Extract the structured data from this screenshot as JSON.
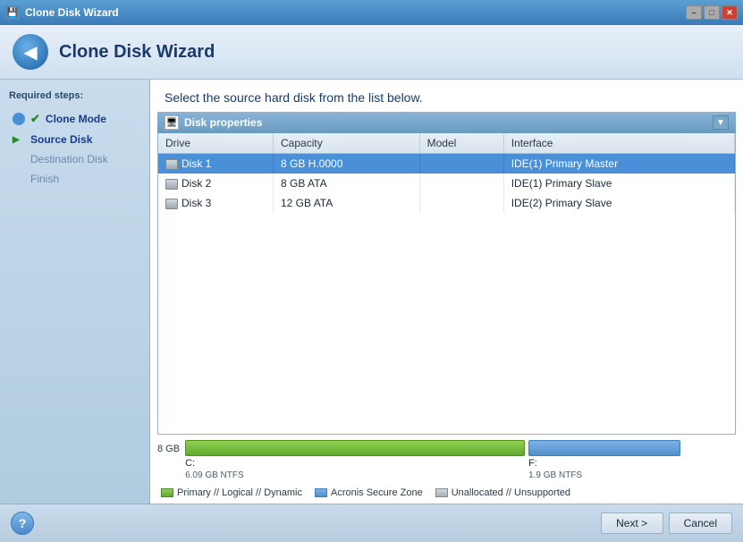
{
  "titlebar": {
    "title": "Clone Disk Wizard",
    "icon": "💾",
    "minimize_label": "–",
    "maximize_label": "□",
    "close_label": "✕"
  },
  "header": {
    "title": "Clone Disk Wizard",
    "icon": "◀"
  },
  "sidebar": {
    "label": "Required steps:",
    "items": [
      {
        "id": "clone-mode",
        "label": "Clone Mode",
        "state": "done"
      },
      {
        "id": "source-disk",
        "label": "Source Disk",
        "state": "current"
      },
      {
        "id": "destination-disk",
        "label": "Destination Disk",
        "state": "inactive"
      },
      {
        "id": "finish",
        "label": "Finish",
        "state": "inactive"
      }
    ]
  },
  "main": {
    "instruction": "Select the source hard disk from the list below.",
    "disk_props": {
      "title": "Disk properties",
      "icon": "🖥"
    },
    "table": {
      "columns": [
        "Drive",
        "Capacity",
        "Model",
        "Interface"
      ],
      "rows": [
        {
          "drive": "Disk 1",
          "capacity": "8 GB H.0000",
          "model": "",
          "interface": "IDE(1) Primary Master",
          "selected": true
        },
        {
          "drive": "Disk 2",
          "capacity": "8 GB ATA",
          "model": "",
          "interface": "IDE(1) Primary Slave",
          "selected": false
        },
        {
          "drive": "Disk 3",
          "capacity": "12 GB ATA",
          "model": "",
          "interface": "IDE(2) Primary Slave",
          "selected": false
        }
      ]
    },
    "partition_viz": {
      "size_label": "8 GB",
      "partitions": [
        {
          "label": "C:",
          "sublabel": "6.09 GB  NTFS",
          "color": "green",
          "width_pct": 65
        },
        {
          "label": "F:",
          "sublabel": "1.9 GB  NTFS",
          "color": "blue",
          "width_pct": 30
        }
      ]
    },
    "legend": [
      {
        "label": "Primary // Logical // Dynamic",
        "color": "green"
      },
      {
        "label": "Acronis Secure Zone",
        "color": "blue"
      },
      {
        "label": "Unallocated // Unsupported",
        "color": "gray"
      }
    ]
  },
  "footer": {
    "help_label": "?",
    "next_label": "Next >",
    "cancel_label": "Cancel"
  }
}
